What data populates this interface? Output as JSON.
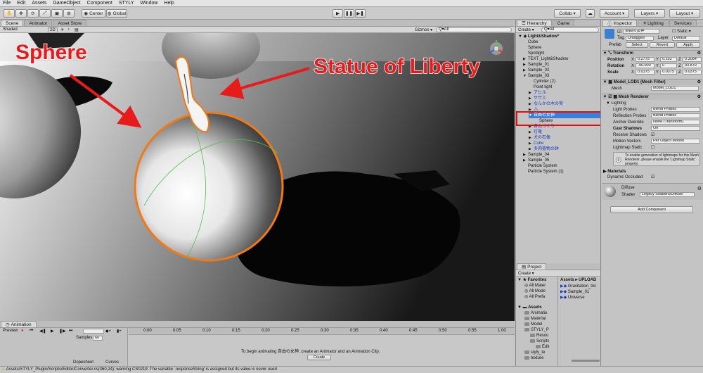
{
  "menu": [
    "File",
    "Edit",
    "Assets",
    "GameObject",
    "Component",
    "STYLY",
    "Window",
    "Help"
  ],
  "toolbar": {
    "pivot_label": "Center",
    "space_label": "Global",
    "collab_label": "Collab ▾",
    "account_label": "Account",
    "layers_label": "Layers",
    "layout_label": "Layout"
  },
  "scene": {
    "tabs": [
      "Scene",
      "Animator",
      "Asset Store"
    ],
    "shading": "Shaded",
    "mode2d": "2D",
    "gizmos": "Gizmos ▾",
    "search_placeholder": "Q▾All",
    "annotation_sphere": "Sphere",
    "annotation_statue": "Statue of Liberty"
  },
  "hierarchy": {
    "tab": "Hierarchy",
    "game_tab": "Game",
    "create": "Create ▾",
    "search": "Q▾All",
    "root": "Light&Shadow*",
    "items": [
      {
        "label": "Cube",
        "indent": 1,
        "arrow": "",
        "blue": false,
        "selected": false
      },
      {
        "label": "Sphere",
        "indent": 1,
        "arrow": "",
        "blue": false,
        "selected": false
      },
      {
        "label": "Spotlight",
        "indent": 1,
        "arrow": "",
        "blue": false,
        "selected": false
      },
      {
        "label": "TEXT_Light&Shadow",
        "indent": 1,
        "arrow": "▶",
        "blue": false,
        "selected": false
      },
      {
        "label": "Sample_01",
        "indent": 1,
        "arrow": "▶",
        "blue": false,
        "selected": false
      },
      {
        "label": "Sample_02",
        "indent": 1,
        "arrow": "▶",
        "blue": false,
        "selected": false
      },
      {
        "label": "Sample_03",
        "indent": 1,
        "arrow": "▼",
        "blue": false,
        "selected": false
      },
      {
        "label": "Cylinder (2)",
        "indent": 2,
        "arrow": "",
        "blue": false,
        "selected": false
      },
      {
        "label": "Point light",
        "indent": 2,
        "arrow": "",
        "blue": false,
        "selected": false
      },
      {
        "label": "アヒル",
        "indent": 2,
        "arrow": "▶",
        "blue": true,
        "selected": false
      },
      {
        "label": "ササエ",
        "indent": 2,
        "arrow": "▶",
        "blue": true,
        "selected": false
      },
      {
        "label": "なんかの木の実",
        "indent": 2,
        "arrow": "▶",
        "blue": true,
        "selected": false
      },
      {
        "label": "ふ",
        "indent": 2,
        "arrow": "▶",
        "blue": true,
        "selected": false
      },
      {
        "label": "自由の女神",
        "indent": 2,
        "arrow": "▼",
        "blue": true,
        "selected": true
      },
      {
        "label": "Sphere",
        "indent": 3,
        "arrow": "",
        "blue": false,
        "selected": false
      },
      {
        "label": "自由づくり",
        "indent": 2,
        "arrow": "▶",
        "blue": true,
        "selected": false
      },
      {
        "label": "灯篭",
        "indent": 2,
        "arrow": "▶",
        "blue": true,
        "selected": false
      },
      {
        "label": "犬の石像",
        "indent": 2,
        "arrow": "▶",
        "blue": true,
        "selected": false
      },
      {
        "label": "Cube",
        "indent": 2,
        "arrow": "▶",
        "blue": true,
        "selected": false
      },
      {
        "label": "多肉植物の鉢",
        "indent": 2,
        "arrow": "▶",
        "blue": true,
        "selected": false
      },
      {
        "label": "Sample_04",
        "indent": 1,
        "arrow": "▶",
        "blue": false,
        "selected": false
      },
      {
        "label": "Sample_05",
        "indent": 1,
        "arrow": "▶",
        "blue": false,
        "selected": false
      },
      {
        "label": "Particle System",
        "indent": 1,
        "arrow": "",
        "blue": false,
        "selected": false
      },
      {
        "label": "Particle System (1)",
        "indent": 1,
        "arrow": "",
        "blue": false,
        "selected": false
      }
    ]
  },
  "project": {
    "tab": "Project",
    "create": "Create ▾",
    "favorites": "Favorites",
    "fav_items": [
      "All Mater",
      "All Mode",
      "All Prefa"
    ],
    "assets": "Assets",
    "asset_tree": [
      "Animatio",
      "Material",
      "Model",
      "STYLY_P",
      "Resou",
      "Scripts",
      "Edit",
      "styly_te",
      "texture"
    ],
    "breadcrumb": "Assets ▸ UPLOAD",
    "files": [
      "Gravitation_tric",
      "Sample_01",
      "Universe"
    ]
  },
  "inspector": {
    "tab": "Inspector",
    "lighting_tab": "Lighting",
    "services_tab": "Services",
    "object_name": "自由の女神",
    "static_label": "Static ▾",
    "tag_label": "Tag",
    "tag_value": "Untagged",
    "layer_label": "Layer",
    "layer_value": "Default",
    "prefab_label": "Prefab",
    "prefab_select": "Select",
    "prefab_revert": "Revert",
    "prefab_apply": "Apply",
    "transform_title": "Transform",
    "position_label": "Position",
    "rotation_label": "Rotation",
    "scale_label": "Scale",
    "position": [
      "0.2775",
      "0.152",
      "0.3084"
    ],
    "rotation": [
      "-90.000",
      "0",
      "93.879"
    ],
    "scale": [
      "0.0375",
      "0.0375",
      "0.0375"
    ],
    "meshfilter_title": "Model_LOD1 (Mesh Filter)",
    "mesh_label": "Mesh",
    "mesh_value": "Model_LOD1",
    "meshrenderer_title": "Mesh Renderer",
    "lighting_label": "Lighting",
    "light_probes_label": "Light Probes",
    "light_probes_value": "Blend Probes",
    "reflection_probes_label": "Reflection Probes",
    "reflection_probes_value": "Blend Probes",
    "anchor_label": "Anchor Override",
    "anchor_value": "None (Transform)",
    "cast_shadows_label": "Cast Shadows",
    "cast_shadows_value": "On",
    "receive_shadows_label": "Receive Shadows",
    "motion_vectors_label": "Motion Vectors",
    "motion_vectors_value": "Per Object Motion",
    "lightmap_static_label": "Lightmap Static",
    "info_text": "To enable generation of lightmaps for this Mesh Renderer, please enable the 'Lightmap Static' property.",
    "materials_label": "Materials",
    "dynamic_occluded_label": "Dynamic Occluded",
    "material_name": "Diffuse",
    "shader_label": "Shader",
    "shader_value": "Legacy Shaders/Diffuse",
    "add_component": "Add Component"
  },
  "animation": {
    "tab": "Animation",
    "preview": "Preview",
    "samples_label": "Samples",
    "samples_value": "60",
    "ticks": [
      "0:00",
      "0:05",
      "0:10",
      "0:15",
      "0:20",
      "0:25",
      "0:30",
      "0:35",
      "0:40",
      "0:45",
      "0:50",
      "0:55",
      "1:00"
    ],
    "dopesheet": "Dopesheet",
    "curves": "Curves",
    "message": "To begin animating 自由の女神, create an Animator and an Animation Clip.",
    "create_button": "Create"
  },
  "status": {
    "message": "Assets/STYLY_Plugin/Scripts/Editor/Converter.cs(360,24): warning CS0219: The variable `responseString' is assigned but its value is never used"
  },
  "colors": {
    "annotation_red": "#e81a1a",
    "selection_orange": "#f07a14",
    "highlight_box": "#e01010"
  }
}
